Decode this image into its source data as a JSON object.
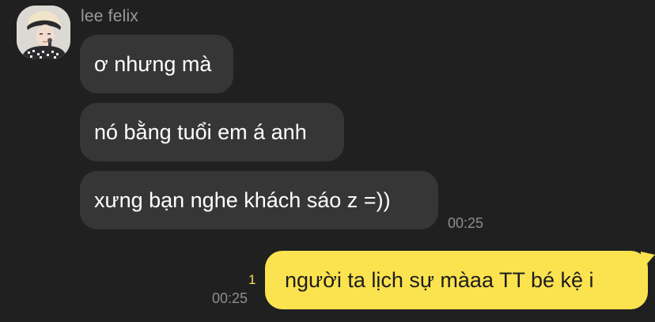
{
  "conversation": {
    "sender_name": "lee felix",
    "incoming": [
      {
        "text": "ơ nhưng mà"
      },
      {
        "text": "nó bằng tuổi em á anh"
      },
      {
        "text": "xưng bạn nghe khách sáo z =))"
      }
    ],
    "incoming_time": "00:25",
    "outgoing": {
      "text": "người ta lịch sự màaa TT bé kệ i",
      "time": "00:25",
      "unread_count": "1"
    }
  },
  "colors": {
    "background": "#202021",
    "incoming_bubble": "#363637",
    "outgoing_bubble": "#fbe34f",
    "unread_count": "#f6df4f",
    "timestamp": "#8e8e90",
    "sender_name": "#9a9a9b"
  },
  "icons": {
    "avatar": "profile-photo-avatar"
  }
}
